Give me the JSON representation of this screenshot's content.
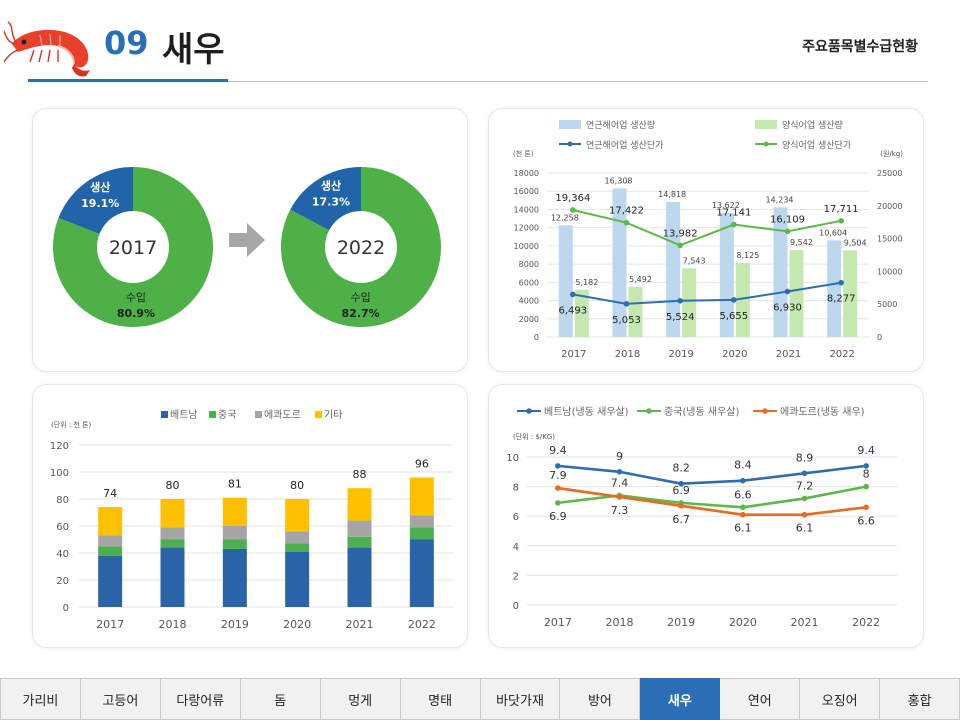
{
  "header": {
    "number": "09",
    "title": "새우",
    "subtitle": "주요품목별수급현황"
  },
  "nav": {
    "active": "새우",
    "items": [
      "가리비",
      "고등어",
      "다랑어류",
      "돔",
      "멍게",
      "명태",
      "바닷가재",
      "방어",
      "새우",
      "연어",
      "오징어",
      "홍합"
    ]
  },
  "colors": {
    "brand": "#2a6fb5",
    "donut_green": "#4db148",
    "donut_blue": "#2164aa",
    "bar_light_blue": "#bdd7ee",
    "bar_light_green": "#c5e8b0",
    "line_blue": "#2e6db4",
    "line_green": "#5cb849",
    "stack_vietnam": "#2a63a8",
    "stack_china": "#4caf50",
    "stack_ecuador": "#a5a5a5",
    "stack_other": "#ffc000",
    "line_orange": "#e86b1f"
  },
  "chart_data": [
    {
      "type": "pie",
      "style": "donut",
      "center_label": "2017",
      "slices": [
        {
          "label": "생산",
          "value": 19.1,
          "text": "19.1%"
        },
        {
          "label": "수입",
          "value": 80.9,
          "text": "80.9%"
        }
      ]
    },
    {
      "type": "pie",
      "style": "donut",
      "center_label": "2022",
      "slices": [
        {
          "label": "생산",
          "value": 17.3,
          "text": "17.3%"
        },
        {
          "label": "수입",
          "value": 82.7,
          "text": "82.7%"
        }
      ]
    },
    {
      "type": "bar",
      "categories": [
        "2017",
        "2018",
        "2019",
        "2020",
        "2021",
        "2022"
      ],
      "left_unit": "(천 톤)",
      "right_unit": "(원/kg)",
      "ylim": [
        0,
        18000
      ],
      "y_ticks": [
        0,
        2000,
        4000,
        6000,
        8000,
        10000,
        12000,
        14000,
        16000,
        18000
      ],
      "y2lim": [
        0,
        25000
      ],
      "y2_ticks": [
        0,
        5000,
        10000,
        15000,
        20000,
        25000
      ],
      "legend": "top",
      "series": [
        {
          "name": "연근해어업 생산량",
          "kind": "bar",
          "axis": "left",
          "values": [
            12258,
            16308,
            14818,
            13622,
            14234,
            10604
          ]
        },
        {
          "name": "양식어업 생산량",
          "kind": "bar",
          "axis": "left",
          "values": [
            5182,
            5492,
            7543,
            8125,
            9542,
            9504
          ]
        },
        {
          "name": "연근해어업 생산단가",
          "kind": "line",
          "axis": "right",
          "values": [
            6493,
            5053,
            5524,
            5655,
            6930,
            8277
          ]
        },
        {
          "name": "양식어업 생산단가",
          "kind": "line",
          "axis": "right",
          "values": [
            19364,
            17422,
            13982,
            17141,
            16109,
            17711
          ]
        }
      ]
    },
    {
      "type": "bar",
      "stacked": true,
      "unit": "(단위 : 천 톤)",
      "categories": [
        "2017",
        "2018",
        "2019",
        "2020",
        "2021",
        "2022"
      ],
      "ylim": [
        0,
        120
      ],
      "y_ticks": [
        0,
        20,
        40,
        60,
        80,
        100,
        120
      ],
      "legend": "top",
      "series": [
        {
          "name": "베트남",
          "values": [
            38,
            44,
            43,
            41,
            44,
            50
          ]
        },
        {
          "name": "중국",
          "values": [
            7,
            6,
            7,
            6,
            8,
            9
          ]
        },
        {
          "name": "에콰도르",
          "values": [
            8,
            9,
            10,
            9,
            12,
            9
          ]
        },
        {
          "name": "기타",
          "values": [
            21,
            21,
            21,
            24,
            24,
            28
          ]
        }
      ],
      "totals": [
        74,
        80,
        81,
        80,
        88,
        96
      ]
    },
    {
      "type": "line",
      "unit": "(단위 : $/KG)",
      "categories": [
        "2017",
        "2018",
        "2019",
        "2020",
        "2021",
        "2022"
      ],
      "ylim": [
        0,
        10
      ],
      "y_ticks": [
        0,
        2,
        4,
        6,
        8,
        10
      ],
      "legend": "top",
      "series": [
        {
          "name": "베트남(냉동 새우살)",
          "values": [
            9.4,
            9,
            8.2,
            8.4,
            8.9,
            9.4
          ]
        },
        {
          "name": "중국(냉동 새우살)",
          "values": [
            6.9,
            7.4,
            6.9,
            6.6,
            7.2,
            8
          ]
        },
        {
          "name": "에콰도르(냉동 새우)",
          "values": [
            7.9,
            7.3,
            6.7,
            6.1,
            6.1,
            6.6
          ]
        }
      ]
    }
  ]
}
